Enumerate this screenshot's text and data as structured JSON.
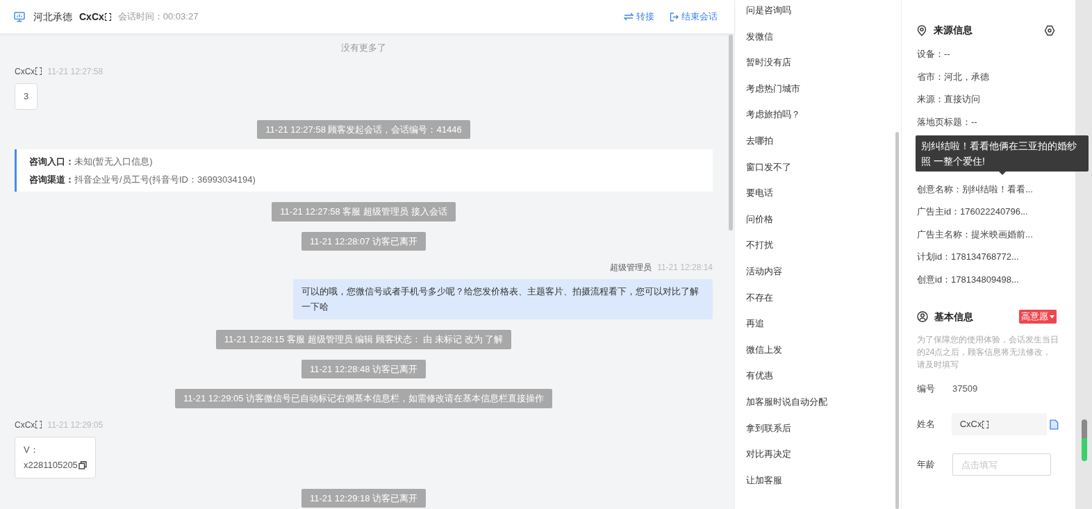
{
  "header": {
    "region": "河北承德",
    "name": "CxCx",
    "session_time": "会话时间：00:03:27",
    "actions": [
      {
        "kind": "transfer",
        "label": "转接"
      },
      {
        "kind": "end",
        "label": "结束会话"
      }
    ]
  },
  "chat": {
    "no_more": "没有更多了",
    "messages": [
      {
        "kind": "customer",
        "name": "CxCx",
        "time": "11-21 12:27:58",
        "lines": [
          "3"
        ]
      },
      {
        "kind": "system",
        "text": "11-21 12:27:58 顾客发起会话，会话编号：41446"
      },
      {
        "kind": "entry",
        "rows": [
          {
            "label": "咨询入口：",
            "value": "未知(暂无入口信息)"
          },
          {
            "label": "咨询渠道：",
            "value": "抖音企业号/员工号(抖音号ID：36993034194)"
          }
        ]
      },
      {
        "kind": "system",
        "text": "11-21 12:27:58 客服 超级管理员 接入会话"
      },
      {
        "kind": "system",
        "text": "11-21 12:28:07 访客已离开"
      },
      {
        "kind": "agent",
        "name": "超级管理员",
        "time": "11-21 12:28:14",
        "lines": [
          "可以的哦，您微信号或者手机号多少呢？给您发价格表、主题客片、拍摄流程看下，您可以对比了解一下哈"
        ]
      },
      {
        "kind": "system",
        "text": "11-21 12:28:15 客服 超级管理员 编辑 顾客状态： 由 未标记 改为 了解"
      },
      {
        "kind": "system",
        "text": "11-21 12:28:48 访客已离开"
      },
      {
        "kind": "system",
        "text": "11-21 12:29:05 访客微信号已自动标记右侧基本信息栏，如需修改请在基本信息栏直接操作"
      },
      {
        "kind": "customer",
        "name": "CxCx",
        "time": "11-21 12:29:05",
        "lines": [
          "V：",
          "x2281105205"
        ],
        "copy": true
      },
      {
        "kind": "system",
        "text": "11-21 12:29:18 访客已离开"
      }
    ]
  },
  "quick_replies": [
    "问是咨询吗",
    "发微信",
    "暂时没有店",
    "考虑热门城市",
    "考虑旅拍吗？",
    "去哪拍",
    "窗口发不了",
    "要电话",
    "问价格",
    "不打扰",
    "活动内容",
    "不存在",
    "再追",
    "微信上发",
    "有优惠",
    "加客服时说自动分配",
    "拿到联系后",
    "对比再决定",
    "让加客服"
  ],
  "source_info": {
    "title": "来源信息",
    "fields_before": [
      "设备：--",
      "省市：河北，承德",
      "来源：直接访问",
      "落地页标题：--"
    ],
    "tooltip": "别纠结啦！看看他俩在三亚拍的婚纱照 一整个爱住!",
    "fields_after": [
      "创意名称：别纠结啦！看看...",
      "广告主id：176022240796...",
      "广告主名称：提米映画婚前...",
      "计划id：178134768772...",
      "创意id：178134809498..."
    ]
  },
  "basic_info": {
    "title": "基本信息",
    "intent_tag": "高意愿",
    "notice": "为了保障您的使用体验，会话发生当日的24点之后，顾客信息将无法修改，请及时填写",
    "fields": [
      {
        "kind": "text",
        "label": "编号",
        "value": "37509"
      },
      {
        "kind": "readonly",
        "label": "姓名",
        "value": "CxCx"
      },
      {
        "kind": "input",
        "label": "年龄",
        "placeholder": "点击填写"
      }
    ]
  }
}
